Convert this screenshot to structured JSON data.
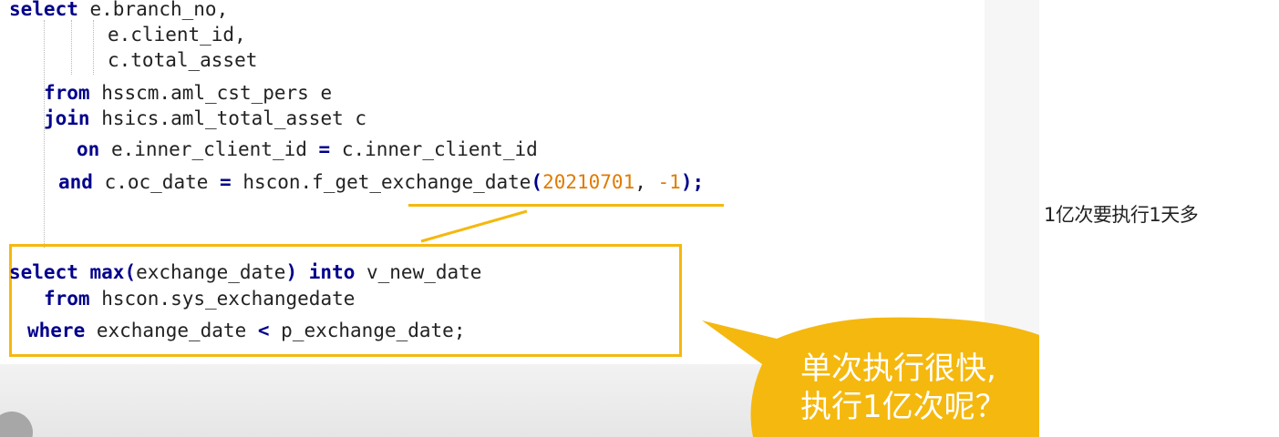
{
  "code": {
    "query1": {
      "l1": {
        "kw": "select",
        "rest": " e.branch_no,"
      },
      "l2": "e.client_id,",
      "l3": "c.total_asset",
      "l4": {
        "kw": "from",
        "rest": " hsscm.aml_cst_pers e"
      },
      "l5": {
        "kw": "join",
        "rest": " hsics.aml_total_asset c"
      },
      "l6": {
        "kw": "on",
        "rest1": " e.inner_client_id ",
        "op": "=",
        "rest2": " c.inner_client_id"
      },
      "l7": {
        "kw": "and",
        "rest1": " c.oc_date ",
        "op": "=",
        "rest2": " hscon.f_get_exchange_date",
        "paren_open": "(",
        "arg1": "20210701",
        "comma": ", ",
        "arg2": "-1",
        "paren_close": ")",
        "semi": ";"
      }
    },
    "query2": {
      "l1": {
        "kw": "select",
        "sp": " ",
        "fn": "max(",
        "arg": "exchange_date",
        "close": ")",
        "sp2": " ",
        "into": "into",
        "rest": " v_new_date"
      },
      "l2": {
        "kw": "from",
        "rest": " hscon.sys_exchangedate"
      },
      "l3": {
        "kw": "where",
        "rest1": " exchange_date ",
        "op": "<",
        "rest2": " p_exchange_date;"
      }
    }
  },
  "callout": {
    "line1": "单次执行很快,",
    "line2": "执行1亿次呢？"
  },
  "side_note": "1亿次要执行1天多",
  "colors": {
    "accent": "#f5b80e",
    "keyword": "#00008b",
    "number": "#e07b00"
  }
}
